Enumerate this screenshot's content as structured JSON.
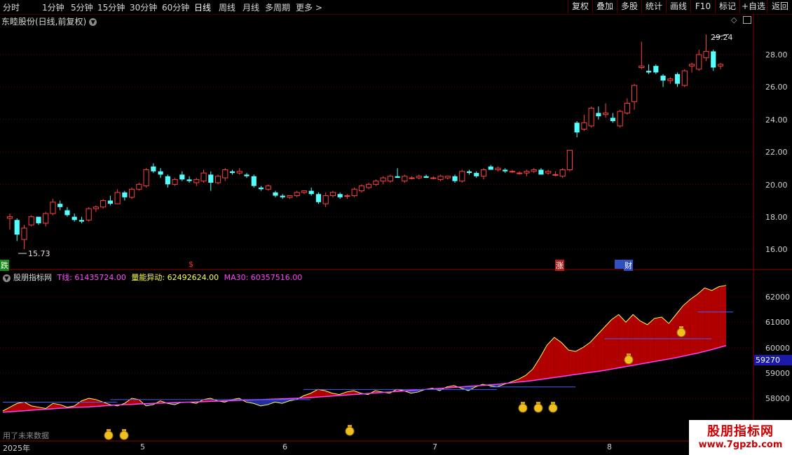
{
  "toolbar": {
    "periods": [
      "分时",
      "1分钟",
      "5分钟",
      "15分钟",
      "30分钟",
      "60分钟",
      "日线",
      "周线",
      "月线",
      "多周期",
      "更多 >"
    ],
    "active_period": "日线",
    "buttons": [
      "复权",
      "叠加",
      "多股",
      "统计",
      "画线",
      "F10",
      "标记",
      "+自选",
      "返回"
    ]
  },
  "stock": {
    "title": "东睦股份(日线,前复权)",
    "high_label": "29.24",
    "low_label": "15.73"
  },
  "price_axis": [
    "28.00",
    "26.00",
    "24.00",
    "22.00",
    "20.00",
    "18.00",
    "16.00"
  ],
  "markers": {
    "die": "跌",
    "dollar": "$",
    "zhang": "涨",
    "cai": "财"
  },
  "indicator": {
    "name": "股朋指标网",
    "t_label": "T线: 61435724.00",
    "lb_label": "量能异动: 62492624.00",
    "ma_label": "MA30: 60357516.00",
    "axis": [
      "62000",
      "61000",
      "60000",
      "59000",
      "58000"
    ],
    "cursor_value": "59270"
  },
  "dates": {
    "year": "2025年",
    "m5": "5",
    "m6": "6",
    "m7": "7",
    "m8": "8"
  },
  "note": "用了未来数据",
  "watermark": {
    "line1": "股朋指标网",
    "line2": "www.7gpzb.com"
  },
  "chart_data": {
    "type": "candlestick",
    "series": [
      {
        "values": [
          [
            17.9,
            18.2,
            17.2,
            18.0
          ],
          [
            17.8,
            17.9,
            16.5,
            16.9
          ],
          [
            16.6,
            17.5,
            16.0,
            17.3
          ],
          [
            17.5,
            18.1,
            17.4,
            18.0
          ],
          [
            18.0,
            18.0,
            17.5,
            17.6
          ],
          [
            17.6,
            18.3,
            17.4,
            18.2
          ],
          [
            18.2,
            19.1,
            18.1,
            18.9
          ],
          [
            18.8,
            19.0,
            18.4,
            18.6
          ],
          [
            18.4,
            18.6,
            18.0,
            18.1
          ],
          [
            18.0,
            18.2,
            17.7,
            17.8
          ],
          [
            17.8,
            18.0,
            17.6,
            17.7
          ],
          [
            17.8,
            18.6,
            17.7,
            18.5
          ],
          [
            18.5,
            18.7,
            18.3,
            18.6
          ],
          [
            18.6,
            19.1,
            18.5,
            19.0
          ],
          [
            19.0,
            19.3,
            18.7,
            18.8
          ],
          [
            18.8,
            19.7,
            18.8,
            19.5
          ],
          [
            19.5,
            19.6,
            19.0,
            19.2
          ],
          [
            19.2,
            19.8,
            19.1,
            19.7
          ],
          [
            19.7,
            20.1,
            19.6,
            20.0
          ],
          [
            19.9,
            21.0,
            19.8,
            20.9
          ],
          [
            21.1,
            21.3,
            20.7,
            20.8
          ],
          [
            20.8,
            21.0,
            20.4,
            20.6
          ],
          [
            20.5,
            20.6,
            19.8,
            20.0
          ],
          [
            20.0,
            20.4,
            19.9,
            20.3
          ],
          [
            20.6,
            20.8,
            20.2,
            20.3
          ],
          [
            20.3,
            20.5,
            20.1,
            20.2
          ],
          [
            20.1,
            20.4,
            19.9,
            20.3
          ],
          [
            20.2,
            20.9,
            20.1,
            20.7
          ],
          [
            20.6,
            20.8,
            19.6,
            20.1
          ],
          [
            20.1,
            20.6,
            20.0,
            20.5
          ],
          [
            20.4,
            21.0,
            20.2,
            20.9
          ],
          [
            20.8,
            20.9,
            20.6,
            20.7
          ],
          [
            20.7,
            21.0,
            20.6,
            20.8
          ],
          [
            20.6,
            20.7,
            20.4,
            20.5
          ],
          [
            20.5,
            20.6,
            19.8,
            19.9
          ],
          [
            19.8,
            19.9,
            19.6,
            19.7
          ],
          [
            19.7,
            20.0,
            19.6,
            19.9
          ],
          [
            19.5,
            19.6,
            19.2,
            19.3
          ],
          [
            19.3,
            19.4,
            19.1,
            19.2
          ],
          [
            19.2,
            19.3,
            19.1,
            19.3
          ],
          [
            19.3,
            19.6,
            19.2,
            19.5
          ],
          [
            19.5,
            19.6,
            19.4,
            19.6
          ],
          [
            19.6,
            19.8,
            19.3,
            19.4
          ],
          [
            19.4,
            19.5,
            18.8,
            18.9
          ],
          [
            18.8,
            19.5,
            18.6,
            19.3
          ],
          [
            19.3,
            19.6,
            19.2,
            19.5
          ],
          [
            19.4,
            19.5,
            19.1,
            19.2
          ],
          [
            19.3,
            19.4,
            19.1,
            19.3
          ],
          [
            19.3,
            19.8,
            19.2,
            19.7
          ],
          [
            19.6,
            20.0,
            19.5,
            19.9
          ],
          [
            19.8,
            20.1,
            19.7,
            20.0
          ],
          [
            20.0,
            20.3,
            19.9,
            20.2
          ],
          [
            20.2,
            20.5,
            20.0,
            20.4
          ],
          [
            20.2,
            20.6,
            20.1,
            20.5
          ],
          [
            20.5,
            21.0,
            20.4,
            20.4
          ],
          [
            20.2,
            20.6,
            20.1,
            20.5
          ],
          [
            20.4,
            20.5,
            20.3,
            20.4
          ],
          [
            20.4,
            20.6,
            20.3,
            20.5
          ],
          [
            20.5,
            20.6,
            20.4,
            20.4
          ],
          [
            20.4,
            20.5,
            20.3,
            20.4
          ],
          [
            20.3,
            20.6,
            20.2,
            20.5
          ],
          [
            20.4,
            20.5,
            20.3,
            20.5
          ],
          [
            20.5,
            20.6,
            20.1,
            20.2
          ],
          [
            20.2,
            20.9,
            20.1,
            20.8
          ],
          [
            20.8,
            20.9,
            20.6,
            20.7
          ],
          [
            20.7,
            20.8,
            20.4,
            20.5
          ],
          [
            20.5,
            21.0,
            20.3,
            20.9
          ],
          [
            21.1,
            21.2,
            20.9,
            20.9
          ],
          [
            20.9,
            21.1,
            20.8,
            21.0
          ],
          [
            20.9,
            21.0,
            20.7,
            20.8
          ],
          [
            20.8,
            20.9,
            20.7,
            20.8
          ],
          [
            20.7,
            20.8,
            20.6,
            20.7
          ],
          [
            20.7,
            20.9,
            20.5,
            20.8
          ],
          [
            20.8,
            21.0,
            20.7,
            20.9
          ],
          [
            20.9,
            21.0,
            20.6,
            20.6
          ],
          [
            20.7,
            20.9,
            20.6,
            20.8
          ],
          [
            20.6,
            20.8,
            20.5,
            20.6
          ],
          [
            20.5,
            21.0,
            20.4,
            20.9
          ],
          [
            20.9,
            22.1,
            20.8,
            22.1
          ],
          [
            23.8,
            23.9,
            22.9,
            23.2
          ],
          [
            23.4,
            24.3,
            23.3,
            23.8
          ],
          [
            23.6,
            24.8,
            23.5,
            24.7
          ],
          [
            24.4,
            24.8,
            24.0,
            24.2
          ],
          [
            24.3,
            25.0,
            24.1,
            24.4
          ],
          [
            24.1,
            24.4,
            23.8,
            23.9
          ],
          [
            23.6,
            24.6,
            23.5,
            24.5
          ],
          [
            24.4,
            25.3,
            24.3,
            25.0
          ],
          [
            25.1,
            26.2,
            24.6,
            26.1
          ],
          [
            27.2,
            28.8,
            27.1,
            27.3
          ],
          [
            27.0,
            27.4,
            26.8,
            26.9
          ],
          [
            27.3,
            27.4,
            26.8,
            26.9
          ],
          [
            26.7,
            26.8,
            26.0,
            26.4
          ],
          [
            26.4,
            26.6,
            26.2,
            26.5
          ],
          [
            26.8,
            26.9,
            26.0,
            26.2
          ],
          [
            26.1,
            27.1,
            26.0,
            27.0
          ],
          [
            27.3,
            27.5,
            26.9,
            27.4
          ],
          [
            27.1,
            28.3,
            27.0,
            28.0
          ],
          [
            27.8,
            29.24,
            27.6,
            28.2
          ],
          [
            28.2,
            28.3,
            27.0,
            27.2
          ],
          [
            27.3,
            27.5,
            27.1,
            27.4
          ]
        ]
      }
    ],
    "t_line": [
      57500,
      57650,
      57800,
      57850,
      57700,
      57650,
      57600,
      57800,
      57750,
      57650,
      57700,
      57900,
      58000,
      57950,
      57850,
      57750,
      57700,
      57800,
      58000,
      57950,
      57700,
      57750,
      57900,
      57800,
      57750,
      57850,
      57850,
      57800,
      57950,
      58000,
      57900,
      57850,
      57950,
      58000,
      57850,
      57800,
      57700,
      57750,
      57850,
      57800,
      57900,
      57950,
      58100,
      58200,
      58350,
      58300,
      58200,
      58150,
      58250,
      58300,
      58200,
      58150,
      58300,
      58250,
      58200,
      58350,
      58300,
      58200,
      58250,
      58350,
      58400,
      58300,
      58450,
      58500,
      58400,
      58300,
      58450,
      58550,
      58500,
      58450,
      58550,
      58650,
      58750,
      58900,
      59150,
      59600,
      60100,
      60400,
      60200,
      59900,
      59850,
      60000,
      60200,
      60500,
      60800,
      61100,
      61300,
      61000,
      61300,
      61050,
      60900,
      61150,
      61200,
      60950,
      61300,
      61650,
      61900,
      62100,
      62350,
      62250,
      62400,
      62450
    ],
    "ma30": [
      57450,
      57470,
      57490,
      57510,
      57530,
      57550,
      57570,
      57590,
      57610,
      57620,
      57640,
      57650,
      57660,
      57680,
      57700,
      57720,
      57740,
      57750,
      57760,
      57780,
      57790,
      57800,
      57810,
      57820,
      57830,
      57840,
      57850,
      57860,
      57870,
      57880,
      57890,
      57900,
      57910,
      57920,
      57930,
      57940,
      57950,
      57960,
      57970,
      57980,
      57990,
      58000,
      58010,
      58030,
      58050,
      58070,
      58090,
      58110,
      58130,
      58150,
      58170,
      58190,
      58210,
      58230,
      58250,
      58270,
      58290,
      58310,
      58330,
      58350,
      58370,
      58390,
      58410,
      58430,
      58450,
      58470,
      58490,
      58510,
      58530,
      58550,
      58580,
      58610,
      58640,
      58670,
      58700,
      58740,
      58780,
      58820,
      58860,
      58900,
      58940,
      58980,
      59020,
      59060,
      59100,
      59150,
      59200,
      59250,
      59300,
      59350,
      59400,
      59450,
      59500,
      59550,
      59600,
      59660,
      59720,
      59780,
      59850,
      59920,
      60000,
      60080
    ]
  }
}
